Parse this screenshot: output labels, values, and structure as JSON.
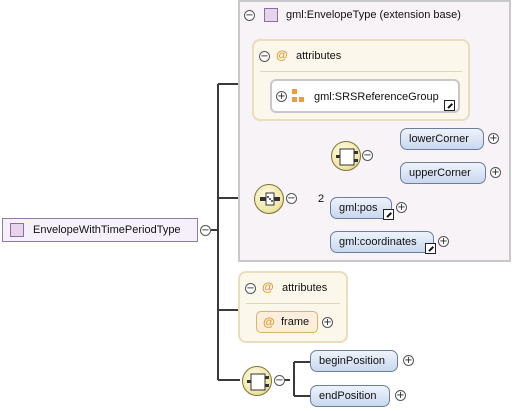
{
  "root": {
    "label": "EnvelopeWithTimePeriodType"
  },
  "extension": {
    "title": "gml:EnvelopeType (extension base)",
    "attributes_label": "attributes",
    "attribute_group": "gml:SRSReferenceGroup",
    "choice_elements": [
      "lowerCorner",
      "upperCorner"
    ],
    "pos": {
      "label": "gml:pos",
      "multiplicity": "2"
    },
    "coordinates": {
      "label": "gml:coordinates"
    }
  },
  "own_attributes": {
    "label": "attributes",
    "items": [
      "frame"
    ]
  },
  "sequence": {
    "elements": [
      "beginPosition",
      "endPosition"
    ]
  }
}
